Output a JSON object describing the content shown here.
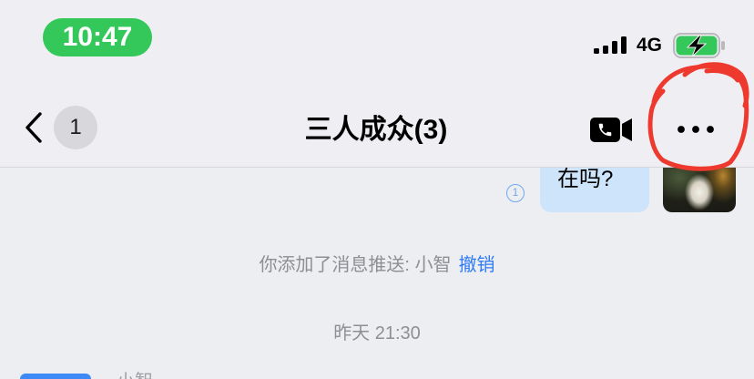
{
  "status_bar": {
    "time": "10:47",
    "network": "4G",
    "signal_icon": "signal-bars-icon",
    "battery_icon": "battery-charging-icon"
  },
  "nav": {
    "back_icon": "chevron-left-icon",
    "unread_badge": "1",
    "title": "三人成众(3)",
    "video_call_icon": "video-call-icon",
    "more_icon": "more-dots-icon"
  },
  "messages": [
    {
      "text": "在吗?",
      "read_receipt": "1"
    }
  ],
  "system_notice": {
    "text": "你添加了消息推送: 小智",
    "action_label": "撤销"
  },
  "timestamp": "昨天 21:30",
  "next_message": {
    "sender_name": "小智"
  },
  "colors": {
    "time_pill": "#34C759",
    "battery_fill": "#34C759",
    "bubble_outgoing": "#CDE4FB",
    "link_blue": "#2F7BF5",
    "read_receipt": "#6FA8F0",
    "secondary_text": "#8E8E93",
    "annotation_red": "#EE3A2E",
    "chat_background": "#EDEEF2",
    "nav_background": "#EFEFF3",
    "badge_background": "#D7D7DC",
    "sender_avatar": "#3D8AF7"
  }
}
